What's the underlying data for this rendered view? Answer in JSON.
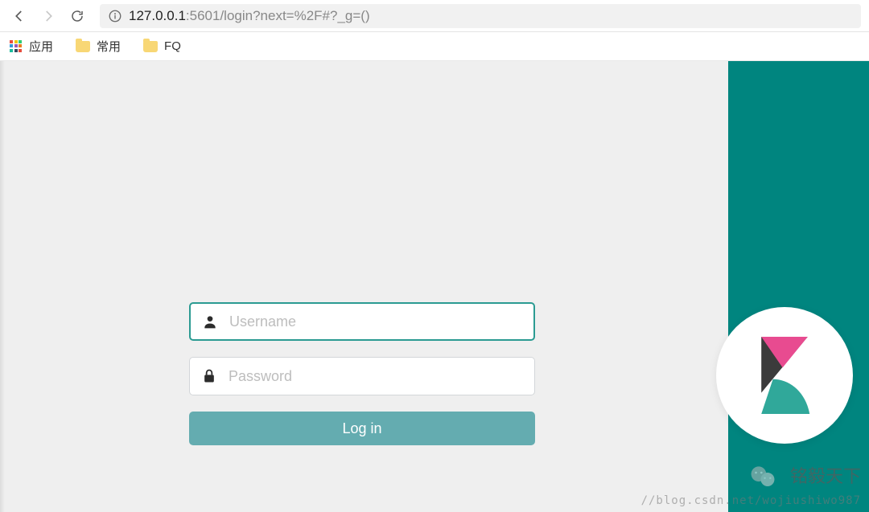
{
  "browser": {
    "url_host": "127.0.0.1",
    "url_rest": ":5601/login?next=%2F#?_g=()"
  },
  "bookmarks": {
    "apps": "应用",
    "folder1": "常用",
    "folder2": "FQ"
  },
  "login": {
    "username_placeholder": "Username",
    "password_placeholder": "Password",
    "button_label": "Log in"
  },
  "watermark": {
    "name": "铭毅天下",
    "url": "//blog.csdn.net/wojiushiwo987"
  },
  "colors": {
    "teal": "#00857f",
    "button": "#64acb0",
    "focus_border": "#2b9b92"
  }
}
